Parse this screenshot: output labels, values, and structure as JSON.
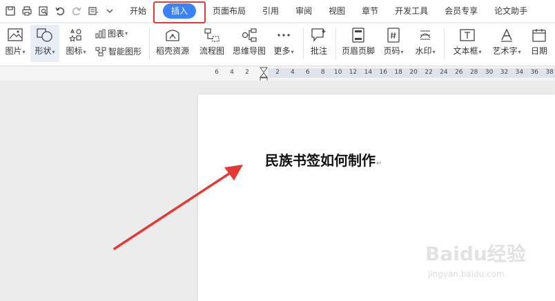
{
  "tabs": [
    {
      "label": "开始",
      "active": false
    },
    {
      "label": "插入",
      "active": true
    },
    {
      "label": "页面布局",
      "active": false
    },
    {
      "label": "引用",
      "active": false
    },
    {
      "label": "审阅",
      "active": false
    },
    {
      "label": "视图",
      "active": false
    },
    {
      "label": "章节",
      "active": false
    },
    {
      "label": "开发工具",
      "active": false
    },
    {
      "label": "会员专享",
      "active": false
    },
    {
      "label": "论文助手",
      "active": false
    }
  ],
  "ribbon": {
    "picture": "图片",
    "shape": "形状",
    "icon": "图标",
    "chart": "图表",
    "smart_graphic": "智能图形",
    "resources": "稻壳资源",
    "flowchart": "流程图",
    "mindmap": "思维导图",
    "more": "更多",
    "comment": "批注",
    "header_footer": "页眉页脚",
    "page_number": "页码",
    "watermark": "水印",
    "textbox": "文本框",
    "wordart": "艺术字",
    "date": "日期"
  },
  "ruler": {
    "left_ticks": [
      "6",
      "4",
      "2"
    ],
    "right_ticks": [
      "2",
      "4",
      "6",
      "8",
      "10",
      "12",
      "14",
      "16",
      "18",
      "20",
      "22",
      "24",
      "26",
      "28",
      "30",
      "32",
      "34",
      "36",
      "38"
    ]
  },
  "document": {
    "heading": "民族书签如何制作"
  },
  "watermark": {
    "brand": "Baidu经验",
    "url": "jingyan.baidu.com"
  },
  "colors": {
    "accent": "#3b82f6",
    "highlight": "#e53935",
    "arrow": "#e53935"
  }
}
